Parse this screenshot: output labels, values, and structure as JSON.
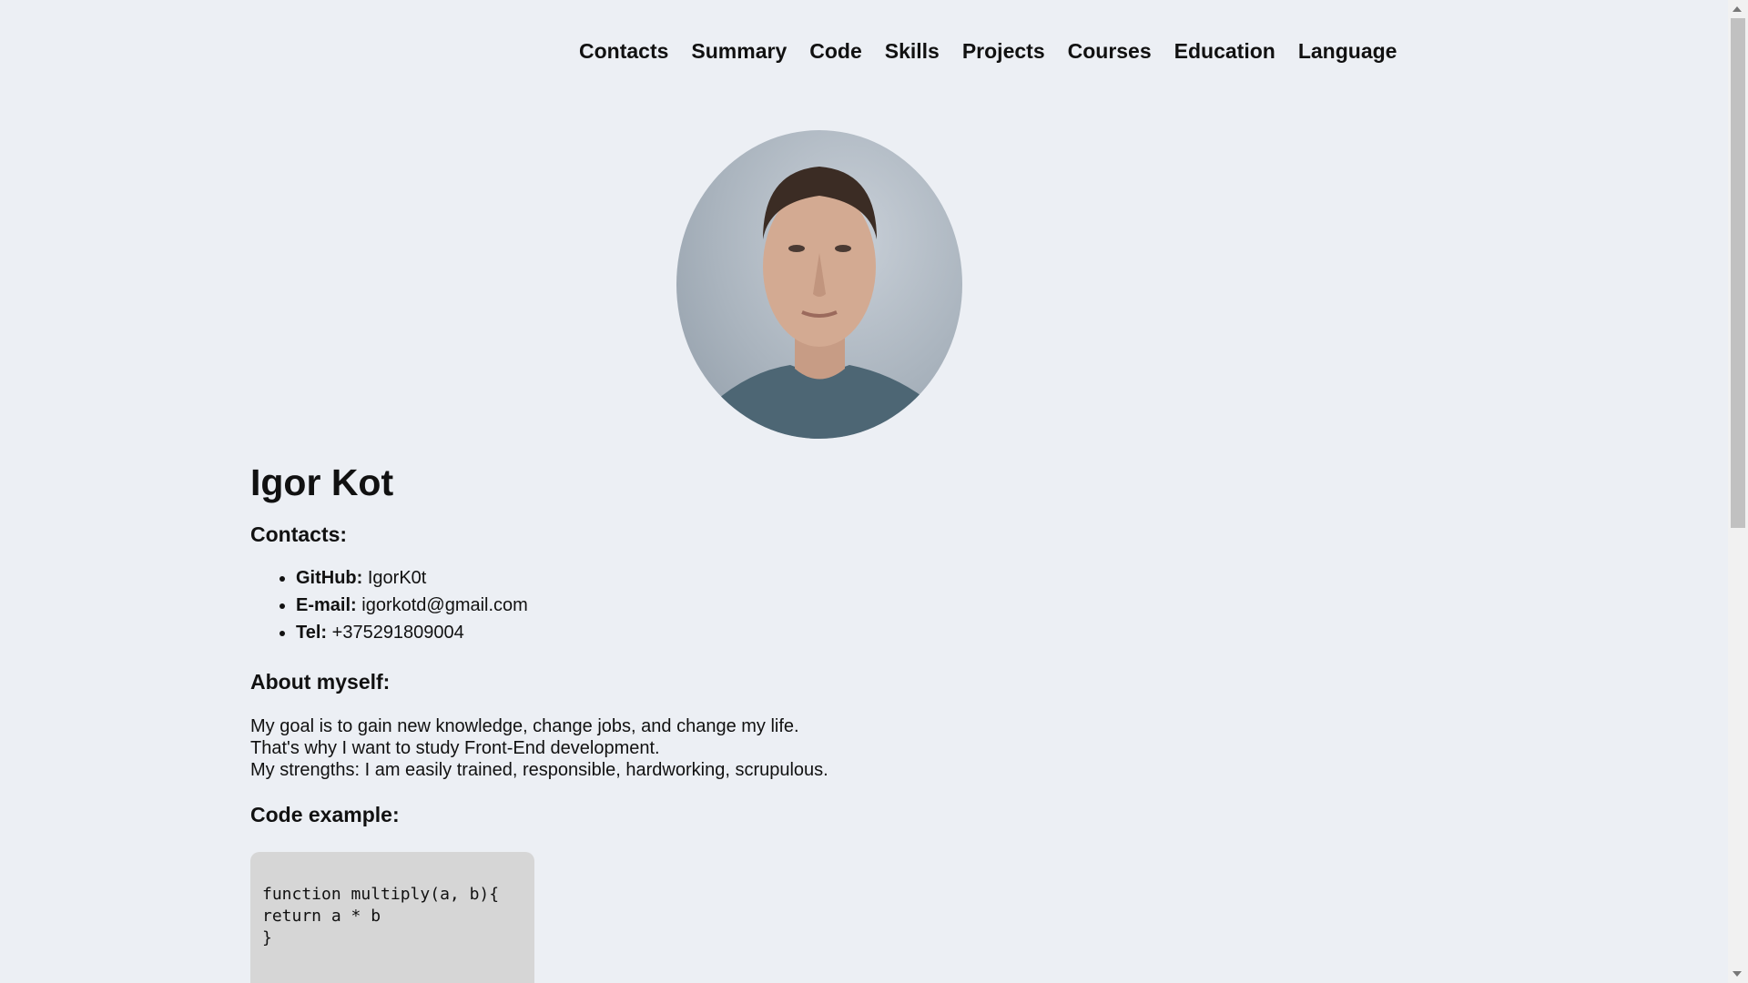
{
  "nav": {
    "items": [
      "Contacts",
      "Summary",
      "Code",
      "Skills",
      "Projects",
      "Courses",
      "Education",
      "Language"
    ]
  },
  "profile": {
    "name": "Igor Kot"
  },
  "contacts": {
    "heading": "Contacts:",
    "github_label": "GitHub:",
    "github_value": "IgorK0t",
    "email_label": "E-mail:",
    "email_value": "igorkotd@gmail.com",
    "tel_label": "Tel:",
    "tel_value": "+375291809004"
  },
  "about": {
    "heading": "About myself:",
    "lines": [
      "My goal is to gain new knowledge, change jobs, and change my life.",
      "That's why I want to study Front-End development.",
      "My strengths: I am easily trained, responsible, hardworking, scrupulous."
    ]
  },
  "code": {
    "heading": "Code example:",
    "lines": [
      "function multiply(a, b){",
      "return a * b",
      "}"
    ]
  }
}
